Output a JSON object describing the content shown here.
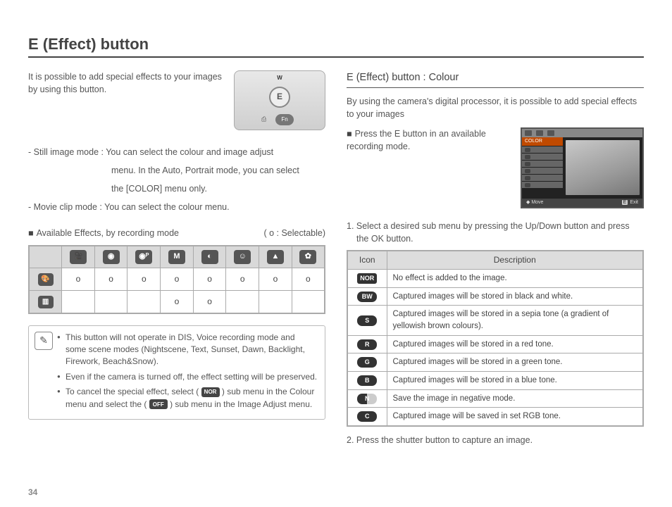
{
  "page_number": "34",
  "title": "E (Effect) button",
  "left": {
    "intro": "It is possible to add special effects to your images by using this button.",
    "camera_labels": {
      "top": "W",
      "center": "E",
      "fn": "Fn",
      "print_icon": "print-icon"
    },
    "still_label": "- Still image mode :",
    "still_line1": "You can select the colour and image adjust",
    "still_line2": "menu. In the Auto, Portrait mode, you can select",
    "still_line3": "the [COLOR] menu only.",
    "movie_line": "- Movie clip mode : You can select the colour menu.",
    "avail_label": "Available Effects, by recording mode",
    "avail_legend": "( o : Selectable)",
    "mode_icons": [
      "movie",
      "auto",
      "program",
      "manual",
      "night",
      "portrait",
      "scene",
      "macro"
    ],
    "row_icons": [
      "palette",
      "adjust"
    ],
    "matrix": [
      [
        "o",
        "o",
        "o",
        "o",
        "o",
        "o",
        "o",
        "o"
      ],
      [
        "",
        "",
        "",
        "o",
        "o",
        "",
        "",
        ""
      ]
    ],
    "notes": {
      "n1": "This button will not operate in DIS, Voice recording mode and some scene modes (Nightscene, Text, Sunset, Dawn, Backlight, Firework, Beach&Snow).",
      "n2": "Even if the camera is turned off, the effect setting will be preserved.",
      "n3a": "To cancel the special effect, select (",
      "n3_icon1": "NOR",
      "n3b": ") sub menu in the Colour menu and select the (",
      "n3_icon2": "OFF",
      "n3c": ") sub menu in the Image Adjust menu."
    }
  },
  "right": {
    "subhead": "E (Effect) button : Colour",
    "intro": "By using the camera's digital processor, it is possible to add special effects to your images",
    "press": "Press the E button in an available recording mode.",
    "lcd": {
      "menu_title": "COLOR",
      "move": "Move",
      "exit_key": "E",
      "exit": "Exit"
    },
    "step1": "1. Select a desired sub menu by pressing the Up/Down button and press the OK button.",
    "table_head": {
      "icon": "Icon",
      "desc": "Description"
    },
    "rows": [
      {
        "icon": "NOR",
        "shape": "pill",
        "desc": "No effect is added to the image."
      },
      {
        "icon": "BW",
        "shape": "oval",
        "desc": "Captured images will be stored in black and white."
      },
      {
        "icon": "S",
        "shape": "oval",
        "desc": "Captured images will be stored in a sepia tone (a gradient of yellowish brown colours)."
      },
      {
        "icon": "R",
        "shape": "oval",
        "desc": "Captured images will be stored in a red tone."
      },
      {
        "icon": "G",
        "shape": "oval",
        "desc": "Captured images will be stored in a green tone."
      },
      {
        "icon": "B",
        "shape": "oval",
        "desc": "Captured images will be stored in a blue tone."
      },
      {
        "icon": "N",
        "shape": "neg",
        "desc": "Save the image in negative mode."
      },
      {
        "icon": "C",
        "shape": "oval",
        "desc": "Captured image will be saved in set RGB tone."
      }
    ],
    "step2": "2. Press the shutter button to capture an image."
  }
}
